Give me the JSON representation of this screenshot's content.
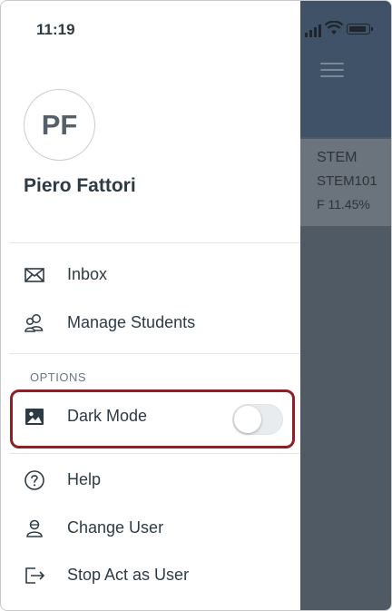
{
  "status_bar": {
    "time": "11:19"
  },
  "user": {
    "initials": "PF",
    "name": "Piero Fattori"
  },
  "menu": {
    "primary": [
      {
        "label": "Inbox",
        "icon": "mail-icon"
      },
      {
        "label": "Manage Students",
        "icon": "users-icon"
      }
    ],
    "options_title": "OPTIONS",
    "options": [
      {
        "label": "Dark Mode",
        "icon": "image-icon",
        "toggle_on": false
      }
    ],
    "secondary": [
      {
        "label": "Help",
        "icon": "help-icon"
      },
      {
        "label": "Change User",
        "icon": "change-user-icon"
      },
      {
        "label": "Stop Act as User",
        "icon": "exit-icon"
      }
    ]
  },
  "background_app": {
    "course_name": "STEM",
    "course_code": "STEM101",
    "course_grade": "F  11.45%"
  },
  "colors": {
    "highlight": "#8f1e25",
    "text": "#2d3b45",
    "overlay": "#505a65"
  }
}
